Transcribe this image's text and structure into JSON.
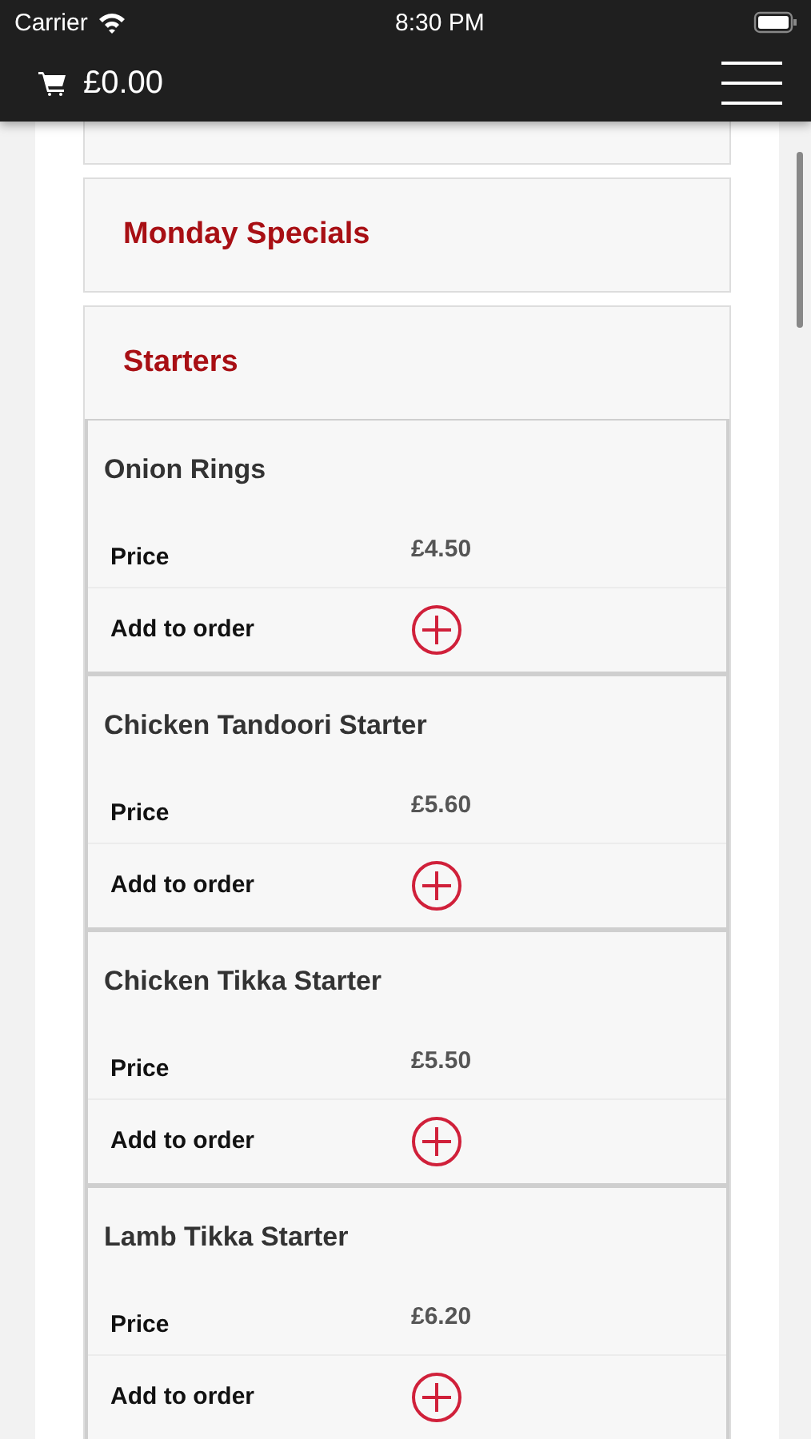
{
  "status_bar": {
    "carrier": "Carrier",
    "time": "8:30 PM"
  },
  "header": {
    "cart_total": "£0.00"
  },
  "categories": [
    {
      "title": "Monday Specials"
    },
    {
      "title": "Starters",
      "items": [
        {
          "name": "Onion Rings",
          "price_label": "Price",
          "price": "£4.50",
          "add_label": "Add to order"
        },
        {
          "name": "Chicken Tandoori Starter",
          "price_label": "Price",
          "price": "£5.60",
          "add_label": "Add to order"
        },
        {
          "name": "Chicken Tikka Starter",
          "price_label": "Price",
          "price": "£5.50",
          "add_label": "Add to order"
        },
        {
          "name": "Lamb Tikka Starter",
          "price_label": "Price",
          "price": "£6.20",
          "add_label": "Add to order"
        }
      ]
    }
  ]
}
